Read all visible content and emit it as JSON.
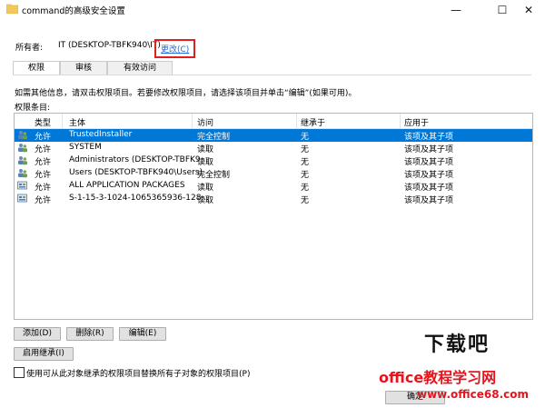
{
  "window": {
    "title": "command的高级安全设置",
    "buttons": [
      "—",
      "☐",
      "✕"
    ]
  },
  "owner": {
    "label": "所有者:",
    "value": "IT (DESKTOP-TBFK940\\IT)",
    "change_link": "更改(C)"
  },
  "tabs": [
    {
      "label": "权限",
      "active": true
    },
    {
      "label": "审核",
      "active": false
    },
    {
      "label": "有效访问",
      "active": false
    }
  ],
  "info_text": "如需其他信息，请双击权限项目。若要修改权限项目，请选择该项目并单击“编辑”(如果可用)。",
  "permissions_label": "权限条目:",
  "table": {
    "columns": [
      "类型",
      "主体",
      "访问",
      "继承于",
      "应用于"
    ],
    "rows": [
      {
        "type": "允许",
        "principal": "TrustedInstaller",
        "access": "完全控制",
        "inherited": "无",
        "applies": "该项及其子项",
        "selected": true,
        "icon": "user-group-icon"
      },
      {
        "type": "允许",
        "principal": "SYSTEM",
        "access": "读取",
        "inherited": "无",
        "applies": "该项及其子项",
        "selected": false,
        "icon": "user-group-icon"
      },
      {
        "type": "允许",
        "principal": "Administrators (DESKTOP-TBFK9...",
        "access": "读取",
        "inherited": "无",
        "applies": "该项及其子项",
        "selected": false,
        "icon": "user-group-icon"
      },
      {
        "type": "允许",
        "principal": "Users (DESKTOP-TBFK940\\Users)",
        "access": "完全控制",
        "inherited": "无",
        "applies": "该项及其子项",
        "selected": false,
        "icon": "user-group-icon"
      },
      {
        "type": "允许",
        "principal": "ALL APPLICATION PACKAGES",
        "access": "读取",
        "inherited": "无",
        "applies": "该项及其子项",
        "selected": false,
        "icon": "package-icon"
      },
      {
        "type": "允许",
        "principal": "S-1-15-3-1024-1065365936-128...",
        "access": "读取",
        "inherited": "无",
        "applies": "该项及其子项",
        "selected": false,
        "icon": "package-icon"
      }
    ]
  },
  "buttons": {
    "add": "添加(D)",
    "remove": "删除(R)",
    "edit": "编辑(E)",
    "enable_inheritance": "启用继承(I)",
    "ok": "确定"
  },
  "replace_checkbox": {
    "label": "使用可从此对象继承的权限项目替换所有子对象的权限项目(P)",
    "checked": false
  },
  "watermark": {
    "brand": "下载吧",
    "site_name": "office教程学习网",
    "url": "www.office68.com"
  },
  "colors": {
    "selection": "#0078d7",
    "highlight_border": "#e0201e",
    "link": "#2a6bd3"
  }
}
